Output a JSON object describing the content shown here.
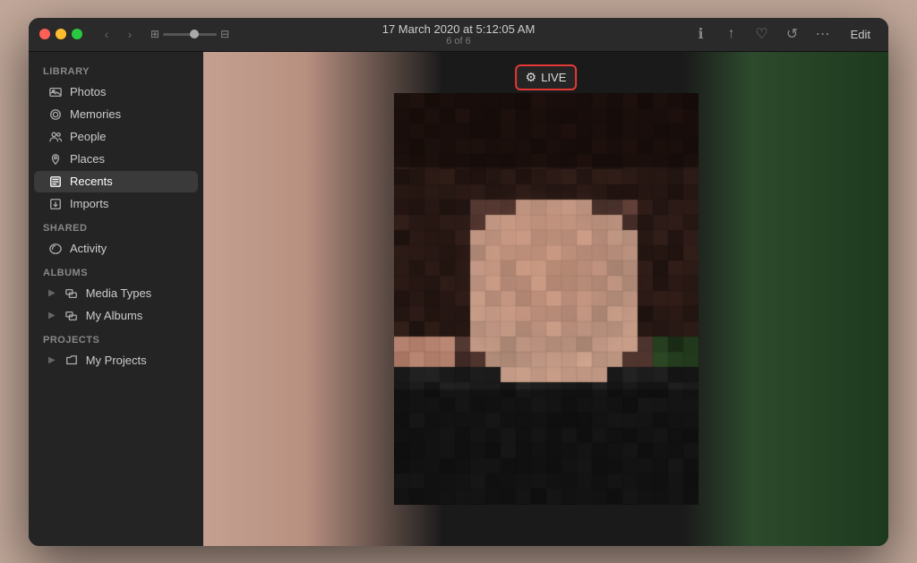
{
  "window": {
    "title": "17 March 2020 at 5:12:05 AM",
    "subtitle": "6 of 6"
  },
  "titlebar": {
    "traffic_lights": [
      "close",
      "minimize",
      "maximize"
    ],
    "back_label": "‹",
    "forward_label": "›",
    "edit_label": "Edit"
  },
  "toolbar_icons": {
    "info": "ℹ",
    "share": "↑",
    "heart": "♡",
    "rotate": "↺",
    "more": "⋯"
  },
  "live_badge": {
    "label": "LIVE",
    "icon": "⚙"
  },
  "sidebar": {
    "library_header": "Library",
    "shared_header": "Shared",
    "albums_header": "Albums",
    "projects_header": "Projects",
    "library_items": [
      {
        "id": "photos",
        "label": "Photos",
        "icon": "photo"
      },
      {
        "id": "memories",
        "label": "Memories",
        "icon": "memories"
      },
      {
        "id": "people",
        "label": "People",
        "icon": "people"
      },
      {
        "id": "places",
        "label": "Places",
        "icon": "places"
      },
      {
        "id": "recents",
        "label": "Recents",
        "icon": "recents",
        "active": true
      },
      {
        "id": "imports",
        "label": "Imports",
        "icon": "imports"
      }
    ],
    "shared_items": [
      {
        "id": "activity",
        "label": "Activity",
        "icon": "activity"
      }
    ],
    "albums_items": [
      {
        "id": "media-types",
        "label": "Media Types",
        "expandable": true
      },
      {
        "id": "my-albums",
        "label": "My Albums",
        "expandable": true
      }
    ],
    "projects_items": [
      {
        "id": "my-projects",
        "label": "My Projects",
        "expandable": true
      }
    ]
  }
}
